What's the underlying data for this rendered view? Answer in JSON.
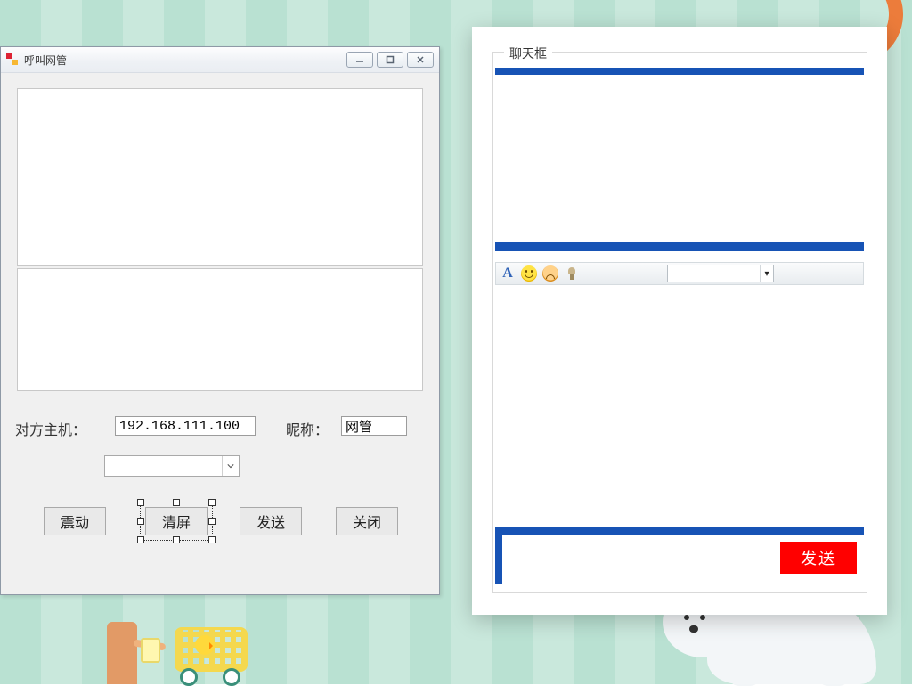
{
  "leftWindow": {
    "title": "呼叫网管",
    "host_label": "对方主机：",
    "host_value": "192.168.111.100",
    "nick_label": "昵称：",
    "nick_value": "网管",
    "combo_value": "",
    "buttons": {
      "shake": "震动",
      "clear": "清屏",
      "send": "发送",
      "close": "关闭"
    }
  },
  "rightPanel": {
    "legend": "聊天框",
    "toolbar": {
      "font_glyph": "A",
      "combo_value": ""
    },
    "send_label": "发送"
  }
}
